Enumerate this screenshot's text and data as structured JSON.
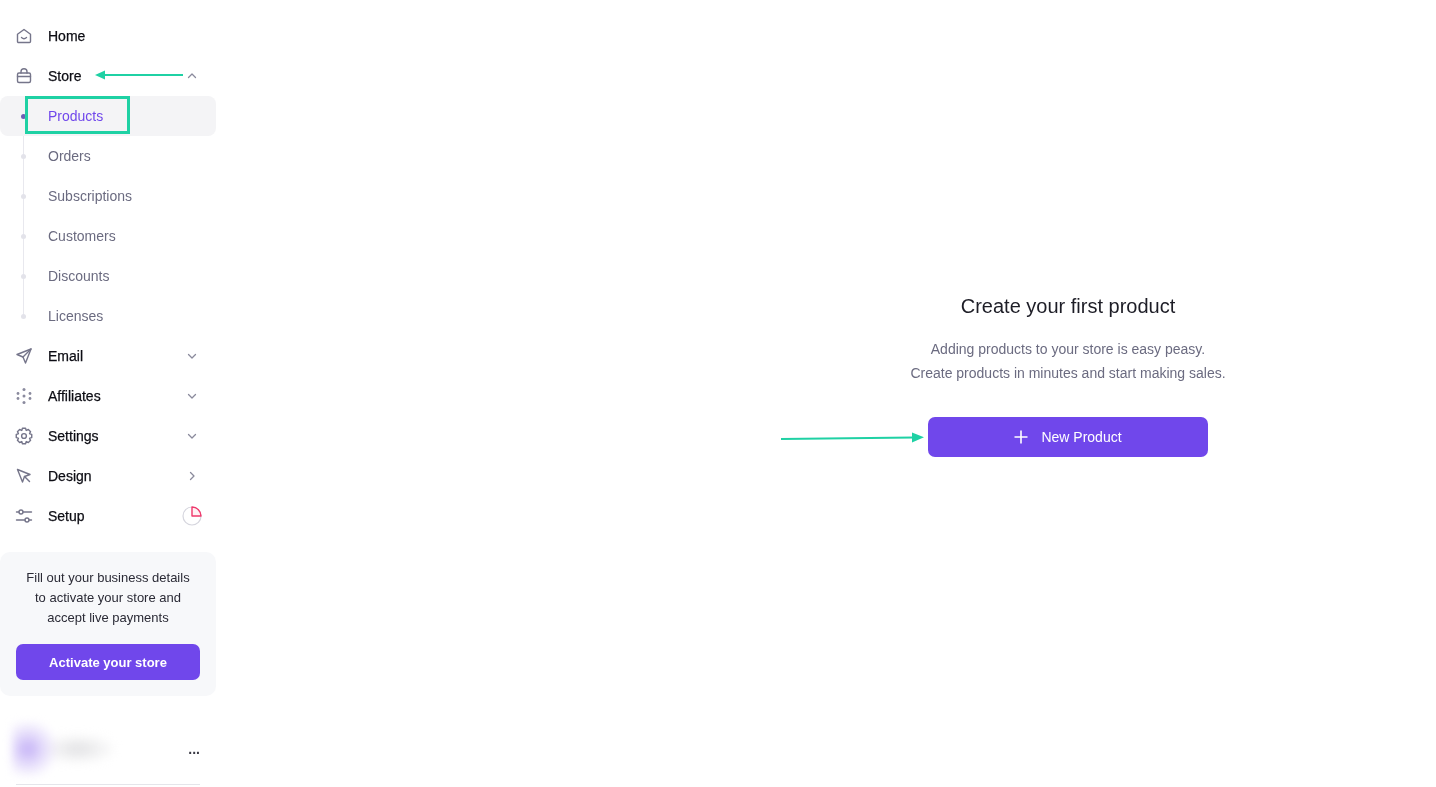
{
  "sidebar": {
    "nav": [
      {
        "kind": "plain",
        "label": "Home",
        "selected": false
      },
      {
        "kind": "group",
        "label": "Store",
        "selected": false,
        "expanded": true,
        "callout": {
          "kind": "arrow"
        },
        "children": [
          {
            "label": "Products",
            "selected": true,
            "callout": {
              "kind": "box"
            }
          },
          {
            "label": "Orders",
            "selected": false
          },
          {
            "label": "Subscriptions",
            "selected": false
          },
          {
            "label": "Customers",
            "selected": false
          },
          {
            "label": "Discounts",
            "selected": false
          },
          {
            "label": "Licenses",
            "selected": false
          }
        ]
      },
      {
        "kind": "group",
        "label": "Email",
        "selected": false,
        "expanded": false
      },
      {
        "kind": "group",
        "label": "Affiliates",
        "selected": false,
        "expanded": false
      },
      {
        "kind": "group",
        "label": "Settings",
        "selected": false,
        "expanded": false
      },
      {
        "kind": "link",
        "label": "Design",
        "selected": false
      },
      {
        "kind": "progress",
        "label": "Setup",
        "selected": false
      }
    ],
    "activation_card": {
      "message": "Fill out your business details to activate your store and accept live payments",
      "button": "Activate your store"
    },
    "profile": {
      "menu": "..."
    }
  },
  "empty_state": {
    "title": "Create your first product",
    "description": [
      "Adding products to your store is easy peasy.",
      "Create products in minutes and start making sales."
    ],
    "button": {
      "label": "New Product",
      "callout": {
        "kind": "arrow"
      }
    }
  }
}
